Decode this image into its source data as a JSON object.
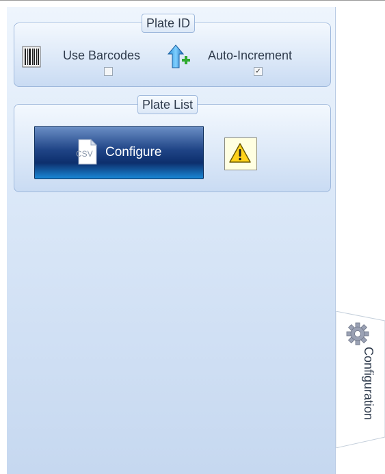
{
  "plate_id": {
    "title": "Plate ID",
    "use_barcodes": {
      "label": "Use Barcodes",
      "checked": false,
      "icon": "barcode-icon"
    },
    "auto_increment": {
      "label": "Auto-Increment",
      "checked": true,
      "icon": "up-arrow-plus-icon"
    }
  },
  "plate_list": {
    "title": "Plate List",
    "configure_button": {
      "label": "Configure",
      "icon_text": "CSV",
      "icon": "csv-file-icon"
    },
    "warning_button": {
      "icon": "warning-icon"
    }
  },
  "side_tab": {
    "label": "Configuration",
    "icon": "gear-icon"
  },
  "colors": {
    "button_blue": "#1f4486",
    "panel_light": "#eef5fd",
    "warning_yellow": "#ffd21a",
    "text": "#2f3b4c"
  }
}
